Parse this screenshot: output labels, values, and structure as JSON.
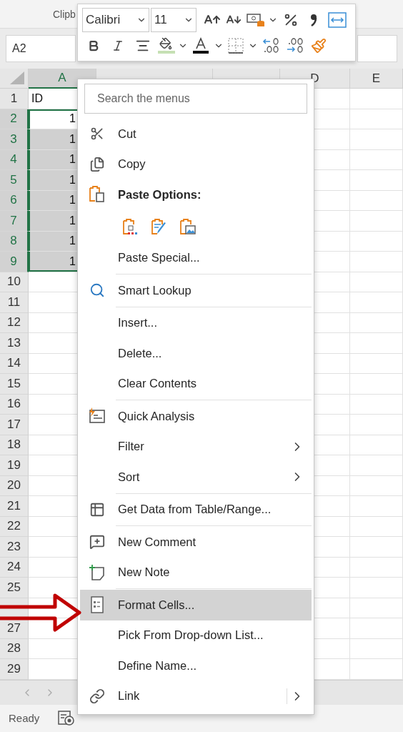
{
  "ribbon": {
    "group_label": "Clipb"
  },
  "name_box": {
    "value": "A2"
  },
  "mini_toolbar": {
    "font": "Calibri",
    "size": "11"
  },
  "sheet": {
    "columns": [
      {
        "label": "A",
        "selected": true
      },
      {
        "selected": false
      },
      {
        "selected": false
      },
      {
        "label": "D",
        "selected": false
      },
      {
        "label": "E",
        "selected": false
      }
    ],
    "rows": [
      {
        "number": "1",
        "selected": false,
        "cell": {
          "text": "ID",
          "kind": "text"
        }
      },
      {
        "number": "2",
        "selected": true,
        "active": true,
        "cell": {
          "text": "1",
          "kind": "number"
        }
      },
      {
        "number": "3",
        "selected": true,
        "active": false,
        "cell": {
          "text": "1",
          "kind": "number"
        }
      },
      {
        "number": "4",
        "selected": true,
        "active": false,
        "cell": {
          "text": "1",
          "kind": "number"
        }
      },
      {
        "number": "5",
        "selected": true,
        "active": false,
        "cell": {
          "text": "1",
          "kind": "number"
        }
      },
      {
        "number": "6",
        "selected": true,
        "active": false,
        "cell": {
          "text": "1",
          "kind": "number"
        }
      },
      {
        "number": "7",
        "selected": true,
        "active": false,
        "cell": {
          "text": "1",
          "kind": "number"
        }
      },
      {
        "number": "8",
        "selected": true,
        "active": false,
        "cell": {
          "text": "1",
          "kind": "number"
        }
      },
      {
        "number": "9",
        "selected": true,
        "active": false,
        "cell": {
          "text": "1",
          "kind": "number"
        }
      },
      {
        "number": "10",
        "selected": false
      },
      {
        "number": "11",
        "selected": false
      },
      {
        "number": "12",
        "selected": false
      },
      {
        "number": "13",
        "selected": false
      },
      {
        "number": "14",
        "selected": false
      },
      {
        "number": "15",
        "selected": false
      },
      {
        "number": "16",
        "selected": false
      },
      {
        "number": "17",
        "selected": false
      },
      {
        "number": "18",
        "selected": false
      },
      {
        "number": "19",
        "selected": false
      },
      {
        "number": "20",
        "selected": false
      },
      {
        "number": "21",
        "selected": false
      },
      {
        "number": "22",
        "selected": false
      },
      {
        "number": "23",
        "selected": false
      },
      {
        "number": "24",
        "selected": false
      },
      {
        "number": "25",
        "selected": false
      },
      {
        "selected": false
      },
      {
        "number": "27",
        "selected": false
      },
      {
        "number": "28",
        "selected": false
      },
      {
        "number": "29",
        "selected": false
      }
    ]
  },
  "context_menu": {
    "search_placeholder": "Search the menus",
    "items": [
      {
        "kind": "item",
        "label": "Cut",
        "selected": false,
        "submenu": false
      },
      {
        "kind": "item",
        "label": "Copy",
        "selected": false,
        "submenu": false
      },
      {
        "kind": "header",
        "label": "Paste Options:"
      },
      {
        "kind": "paste_options"
      },
      {
        "kind": "item",
        "label": "Paste Special...",
        "selected": false,
        "submenu": false
      },
      {
        "kind": "separator"
      },
      {
        "kind": "item",
        "label": "Smart Lookup",
        "selected": false,
        "submenu": false
      },
      {
        "kind": "separator"
      },
      {
        "kind": "item",
        "label": "Insert...",
        "selected": false,
        "submenu": false
      },
      {
        "kind": "item",
        "label": "Delete...",
        "selected": false,
        "submenu": false
      },
      {
        "kind": "item",
        "label": "Clear Contents",
        "selected": false,
        "submenu": false
      },
      {
        "kind": "separator"
      },
      {
        "kind": "item",
        "label": "Quick Analysis",
        "selected": false,
        "submenu": false
      },
      {
        "kind": "item",
        "label": "Filter",
        "selected": false,
        "submenu": true
      },
      {
        "kind": "item",
        "label": "Sort",
        "selected": false,
        "submenu": true
      },
      {
        "kind": "separator"
      },
      {
        "kind": "item",
        "label": "Get Data from Table/Range...",
        "selected": false,
        "submenu": false
      },
      {
        "kind": "separator"
      },
      {
        "kind": "item",
        "label": "New Comment",
        "selected": false,
        "submenu": false
      },
      {
        "kind": "item",
        "label": "New Note",
        "selected": false,
        "submenu": false
      },
      {
        "kind": "separator"
      },
      {
        "kind": "item",
        "label": "Format Cells...",
        "selected": true,
        "submenu": false
      },
      {
        "kind": "item",
        "label": "Pick From Drop-down List...",
        "selected": false,
        "submenu": false
      },
      {
        "kind": "item",
        "label": "Define Name...",
        "selected": false,
        "submenu": false
      },
      {
        "kind": "item",
        "label": "Link",
        "selected": false,
        "submenu": true
      }
    ]
  },
  "status_bar": {
    "text": "Ready"
  }
}
